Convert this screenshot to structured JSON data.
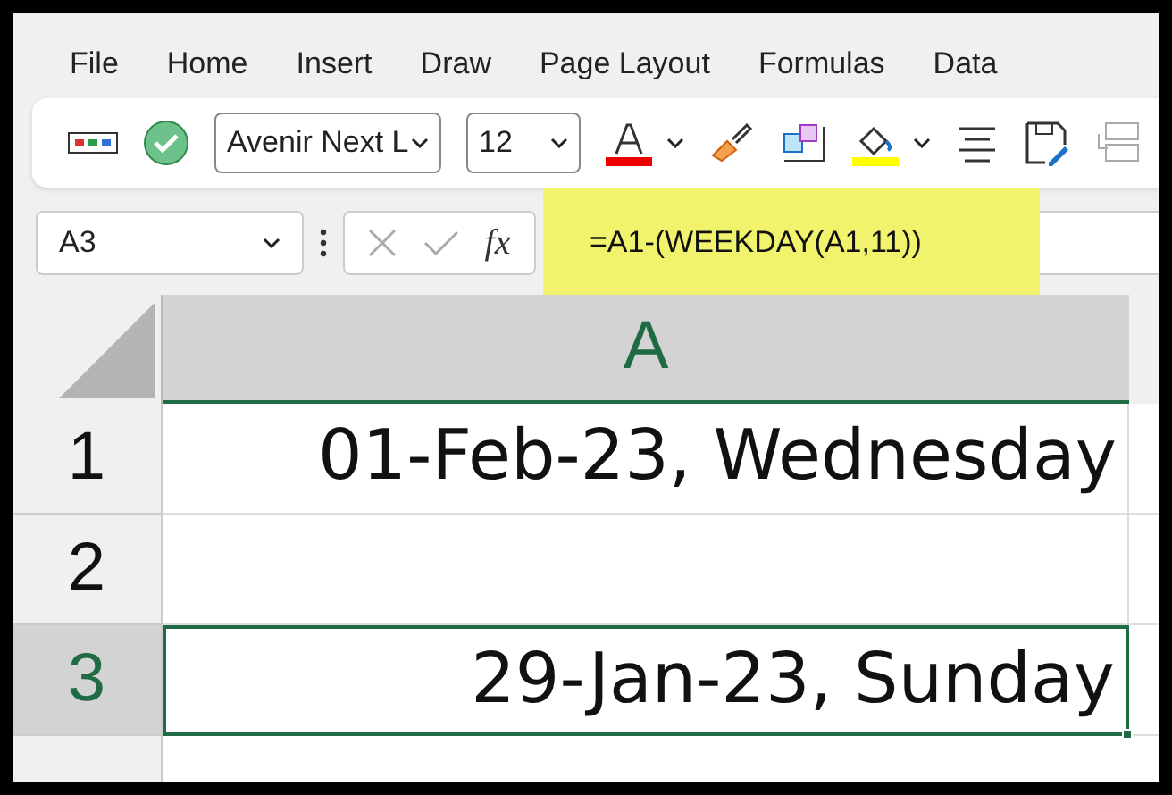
{
  "menu": [
    {
      "label": "File"
    },
    {
      "label": "Home"
    },
    {
      "label": "Insert"
    },
    {
      "label": "Draw"
    },
    {
      "label": "Page Layout"
    },
    {
      "label": "Formulas"
    },
    {
      "label": "Data"
    }
  ],
  "toolbar": {
    "font": "Avenir Next L",
    "size": "12"
  },
  "formula_bar": {
    "name_box": "A3",
    "formula": "=A1-(WEEKDAY(A1,11))",
    "fx": "fx"
  },
  "columns": [
    {
      "label": "A",
      "selected": true
    }
  ],
  "rows": [
    {
      "header": "1",
      "selected": false,
      "value": "01-Feb-23, Wednesday"
    },
    {
      "header": "2",
      "selected": false,
      "value": ""
    },
    {
      "header": "3",
      "selected": true,
      "value": "29-Jan-23, Sunday"
    }
  ]
}
